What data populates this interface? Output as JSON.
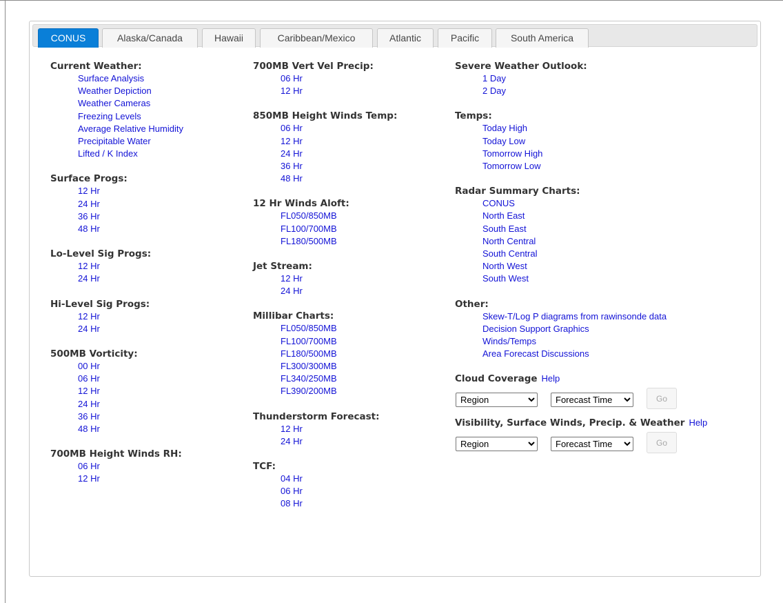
{
  "tabs": [
    "CONUS",
    "Alaska/Canada",
    "Hawaii",
    "Caribbean/Mexico",
    "Atlantic",
    "Pacific",
    "South America"
  ],
  "active_tab": "CONUS",
  "colors": {
    "accent": "#0a7fd8",
    "link": "#1212d6",
    "heading": "#333333"
  },
  "col1": [
    {
      "title": "Current Weather:",
      "links": [
        "Surface Analysis",
        "Weather Depiction",
        "Weather Cameras",
        "Freezing Levels",
        "Average Relative Humidity",
        "Precipitable Water",
        "Lifted / K Index"
      ]
    },
    {
      "title": "Surface Progs:",
      "links": [
        "12 Hr",
        "24 Hr",
        "36 Hr",
        "48 Hr"
      ]
    },
    {
      "title": "Lo-Level Sig Progs:",
      "links": [
        "12 Hr",
        "24 Hr"
      ]
    },
    {
      "title": "Hi-Level Sig Progs:",
      "links": [
        "12 Hr",
        "24 Hr"
      ]
    },
    {
      "title": "500MB Vorticity:",
      "links": [
        "00 Hr",
        "06 Hr",
        "12 Hr",
        "24 Hr",
        "36 Hr",
        "48 Hr"
      ]
    },
    {
      "title": "700MB Height Winds RH:",
      "links": [
        "06 Hr",
        "12 Hr"
      ]
    }
  ],
  "col2": [
    {
      "title": "700MB Vert Vel Precip:",
      "links": [
        "06 Hr",
        "12 Hr"
      ]
    },
    {
      "title": "850MB Height Winds Temp:",
      "links": [
        "06 Hr",
        "12 Hr",
        "24 Hr",
        "36 Hr",
        "48 Hr"
      ]
    },
    {
      "title": "12 Hr Winds Aloft:",
      "links": [
        "FL050/850MB",
        "FL100/700MB",
        "FL180/500MB"
      ]
    },
    {
      "title": "Jet Stream:",
      "links": [
        "12 Hr",
        "24 Hr"
      ]
    },
    {
      "title": "Millibar Charts:",
      "links": [
        "FL050/850MB",
        "FL100/700MB",
        "FL180/500MB",
        "FL300/300MB",
        "FL340/250MB",
        "FL390/200MB"
      ]
    },
    {
      "title": "Thunderstorm Forecast:",
      "links": [
        "12 Hr",
        "24 Hr"
      ]
    },
    {
      "title": "TCF:",
      "links": [
        "04 Hr",
        "06 Hr",
        "08 Hr"
      ]
    }
  ],
  "col3": [
    {
      "title": "Severe Weather Outlook:",
      "links": [
        "1 Day",
        "2 Day"
      ]
    },
    {
      "title": "Temps:",
      "links": [
        "Today High",
        "Today Low",
        "Tomorrow High",
        "Tomorrow Low"
      ]
    },
    {
      "title": "Radar Summary Charts:",
      "links": [
        "CONUS",
        "North East",
        "South East",
        "North Central",
        "South Central",
        "North West",
        "South West"
      ]
    },
    {
      "title": "Other:",
      "links": [
        "Skew-T/Log P diagrams from rawinsonde data",
        "Decision Support Graphics",
        "Winds/Temps",
        "Area Forecast Discussions"
      ]
    }
  ],
  "cloud": {
    "title": "Cloud Coverage",
    "help": "Help",
    "region": "Region",
    "time": "Forecast Time",
    "go": "Go"
  },
  "vis": {
    "title": "Visibility, Surface Winds, Precip. & Weather",
    "help": "Help",
    "region": "Region",
    "time": "Forecast Time",
    "go": "Go"
  }
}
